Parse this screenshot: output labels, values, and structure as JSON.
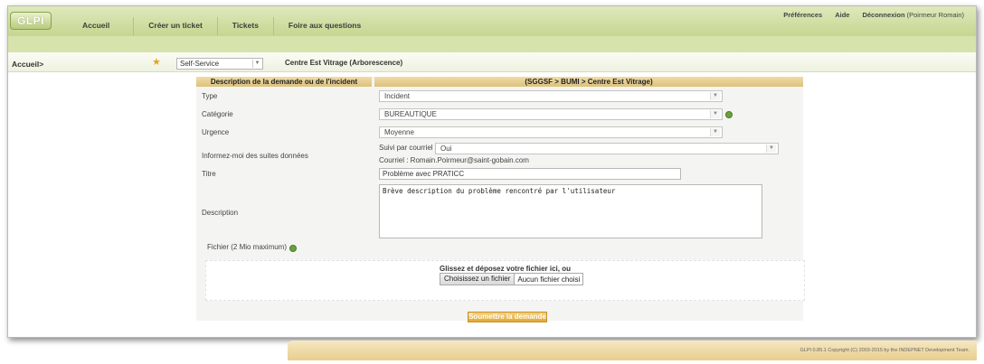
{
  "app": {
    "logo": "GLPI"
  },
  "menu": [
    "Accueil",
    "Créer un ticket",
    "Tickets",
    "Foire aux questions"
  ],
  "topright": {
    "preferences": "Préférences",
    "help": "Aide",
    "logout": "Déconnexion",
    "user": "(Poirmeur Romain)"
  },
  "breadcrumb": {
    "home": "Accueil>",
    "entity_select": "Self-Service",
    "entity": "Centre Est Vitrage (Arborescence)"
  },
  "form": {
    "header_left": "Description de la demande ou de l'incident",
    "header_right": "(SGGSF > BUMI > Centre Est Vitrage)",
    "type_label": "Type",
    "type_value": "Incident",
    "category_label": "Catégorie",
    "category_value": "BUREAUTIQUE",
    "urgency_label": "Urgence",
    "urgency_value": "Moyenne",
    "followup_label": "Informez-moi des suites données",
    "followup_mail_label": "Suivi par courriel",
    "followup_mail_value": "Oui",
    "followup_email": "Courriel : Romain.Poirmeur@saint-gobain.com",
    "title_label": "Titre",
    "title_value": "Problème avec PRATICC",
    "description_label": "Description",
    "description_value": "Brève description du problème rencontré par l'utilisateur",
    "file_label": "Fichier (2 Mio maximum)",
    "dropzone_text": "Glissez et déposez votre fichier ici, ou",
    "file_button": "Choisissez un fichier",
    "file_none": "Aucun fichier choisi",
    "submit": "Soumettre la demande"
  },
  "footer": {
    "copyright": "GLPI 0.85.1 Copyright (C) 2003-2015 by the INDEPNET Development Team."
  },
  "colors": {
    "header_green": "#c5d68f",
    "table_header": "#dcc17b",
    "submit": "#e2a832"
  }
}
